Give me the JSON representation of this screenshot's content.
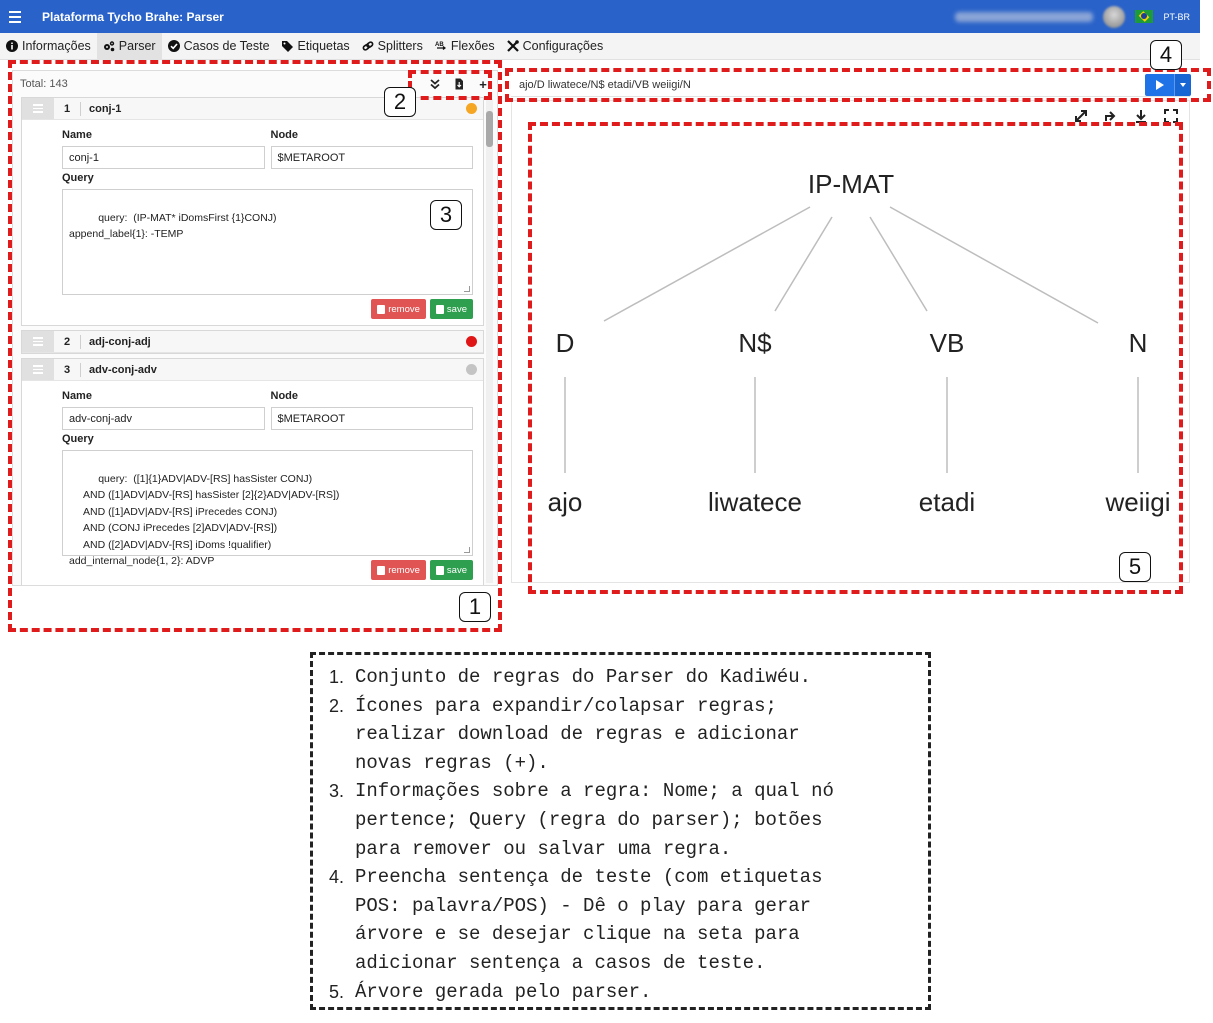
{
  "app": {
    "title": "Plataforma Tycho Brahe: Parser",
    "language": "PT-BR"
  },
  "menu": [
    {
      "label": "Informações",
      "icon": "info-icon"
    },
    {
      "label": "Parser",
      "icon": "cogs-icon",
      "active": true
    },
    {
      "label": "Casos de Teste",
      "icon": "check-circle-icon"
    },
    {
      "label": "Etiquetas",
      "icon": "tags-icon"
    },
    {
      "label": "Splitters",
      "icon": "link-icon"
    },
    {
      "label": "Flexões",
      "icon": "sort-alpha-icon"
    },
    {
      "label": "Configurações",
      "icon": "tools-icon"
    }
  ],
  "rules_panel": {
    "total": "Total: 143",
    "tools": {
      "collapse_icon": "chevrons-down-icon",
      "download_icon": "file-download-icon",
      "add_label": "+"
    },
    "labels": {
      "name": "Name",
      "node": "Node",
      "query": "Query",
      "remove": "remove",
      "save": "save"
    },
    "rules": [
      {
        "num": "1",
        "title": "conj-1",
        "status_color": "#f5a623",
        "expanded": true,
        "name": "conj-1",
        "node": "$METAROOT",
        "query": "query:  (IP-MAT* iDomsFirst {1}CONJ)\nappend_label{1}: -TEMP"
      },
      {
        "num": "2",
        "title": "adj-conj-adj",
        "status_color": "#e01616",
        "expanded": false
      },
      {
        "num": "3",
        "title": "adv-conj-adv",
        "status_color": "#c4c4c4",
        "expanded": true,
        "name": "adv-conj-adv",
        "node": "$METAROOT",
        "query": "query:  ([1]{1}ADV|ADV-[RS] hasSister CONJ)\n     AND ([1]ADV|ADV-[RS] hasSister [2]{2}ADV|ADV-[RS])\n     AND ([1]ADV|ADV-[RS] iPrecedes CONJ)\n     AND (CONJ iPrecedes [2]ADV|ADV-[RS])\n     AND ([2]ADV|ADV-[RS] iDoms !qualifier)\nadd_internal_node{1, 2}: ADVP"
      }
    ]
  },
  "sentence": {
    "value": "ajo/D liwatece/N$ etadi/VB weiigi/N"
  },
  "tree_tools": [
    "expand-arrows-icon",
    "share-tree-icon",
    "download-arrow-icon",
    "fullscreen-icon"
  ],
  "tree": {
    "root": "IP-MAT",
    "pos": [
      "D",
      "N$",
      "VB",
      "N"
    ],
    "words": [
      "ajo",
      "liwatece",
      "etadi",
      "weiigi"
    ]
  },
  "annotations": [
    "1",
    "2",
    "3",
    "4",
    "5"
  ],
  "legend": [
    {
      "num": "1.",
      "lines": [
        "Conjunto de regras do Parser do Kadiwéu."
      ]
    },
    {
      "num": "2.",
      "lines": [
        "Ícones para expandir/colapsar regras;",
        "realizar download de regras e adicionar",
        "novas regras (+)."
      ]
    },
    {
      "num": "3.",
      "lines": [
        "Informações sobre a regra: Nome; a qual nó",
        "pertence; Query (regra do parser); botões",
        "para remover ou salvar uma regra."
      ]
    },
    {
      "num": "4.",
      "lines": [
        "Preencha sentença de teste (com etiquetas",
        "POS: palavra/POS) - Dê o play para gerar",
        "árvore e se desejar clique na seta para",
        "adicionar sentença a casos de teste."
      ]
    },
    {
      "num": "5.",
      "lines": [
        "Árvore gerada pelo parser."
      ]
    }
  ],
  "colors": {
    "brand": "#2962c9",
    "annotation": "#e01b1b",
    "play": "#1f73e6"
  }
}
